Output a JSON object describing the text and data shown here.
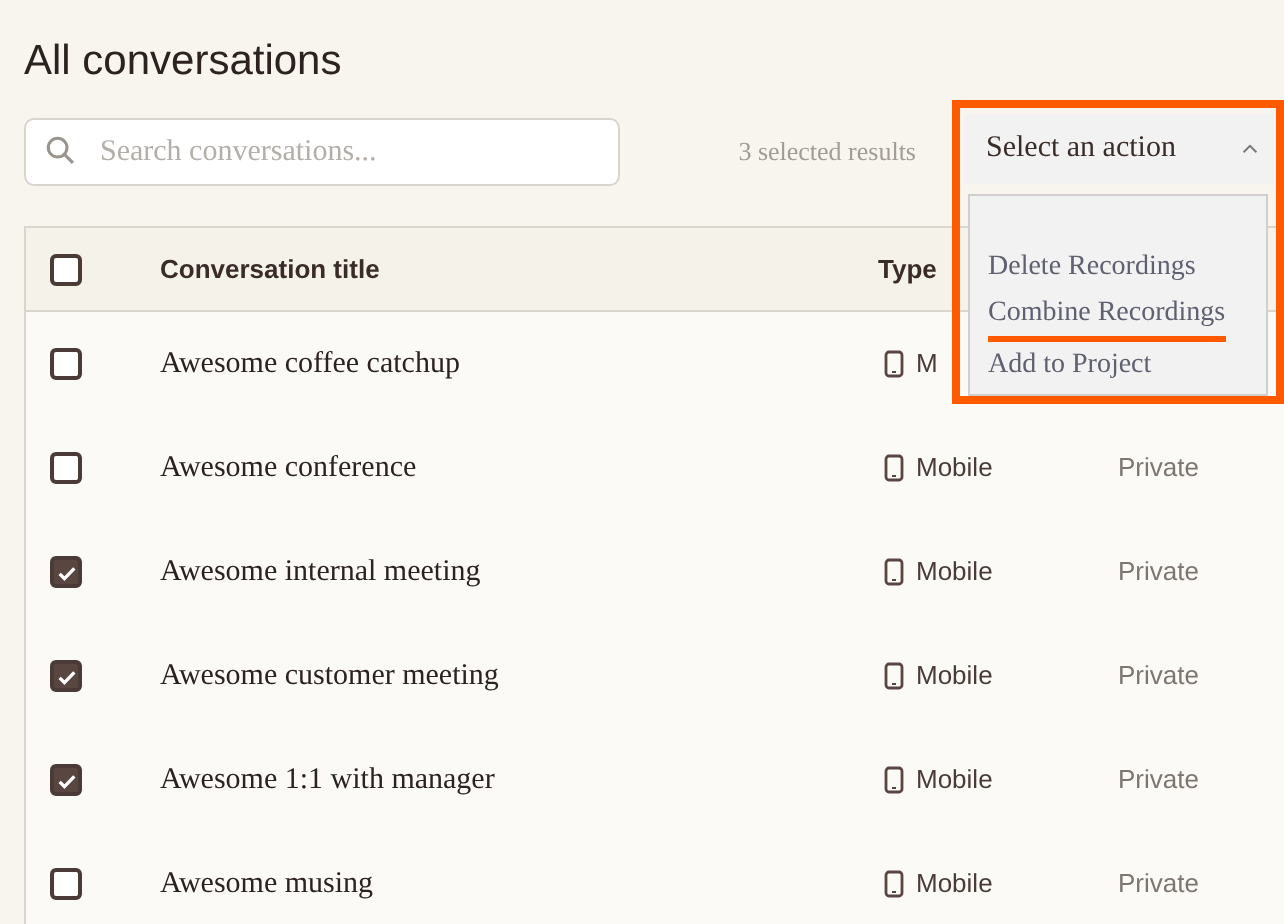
{
  "page_title": "All conversations",
  "search": {
    "placeholder": "Search conversations..."
  },
  "selection_count": "3 selected results",
  "action_select": {
    "value": "Select an action",
    "expanded": true,
    "highlighted": true,
    "options": [
      {
        "label": "Delete Recordings",
        "selected": false
      },
      {
        "label": "Combine Recordings",
        "selected": true
      },
      {
        "label": "Add to Project",
        "selected": false
      }
    ]
  },
  "table": {
    "header_checked": false,
    "columns": [
      "Conversation title",
      "Type"
    ],
    "rows": [
      {
        "checked": false,
        "title": "Awesome coffee catchup",
        "type": "M"
      },
      {
        "checked": false,
        "title": "Awesome conference",
        "type": "Mobile",
        "privacy": "Private"
      },
      {
        "checked": true,
        "title": "Awesome internal meeting",
        "type": "Mobile",
        "privacy": "Private"
      },
      {
        "checked": true,
        "title": "Awesome customer meeting",
        "type": "Mobile",
        "privacy": "Private"
      },
      {
        "checked": true,
        "title": "Awesome 1:1 with manager",
        "type": "Mobile",
        "privacy": "Private"
      },
      {
        "checked": false,
        "title": "Awesome musing",
        "type": "Mobile",
        "privacy": "Private"
      }
    ]
  }
}
